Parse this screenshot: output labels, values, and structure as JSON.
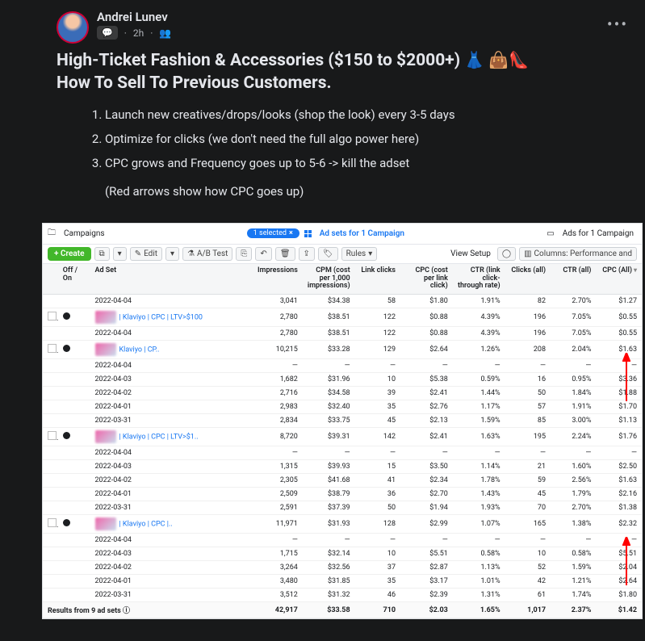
{
  "post": {
    "author": "Andrei Lunev",
    "time": "2h",
    "badge_glyph": "💬",
    "audience_glyph": "👥",
    "headline_plain": "High-Ticket Fashion & Accessories ($150 to $2000+)",
    "headline_emoji": "👗 👜👠",
    "headline_line2": "How To Sell To Previous Customers.",
    "tips": [
      "Launch new creatives/drops/looks (shop the look) every 3-5 days",
      "Optimize for clicks (we don't need the full algo power here)",
      "CPC grows and Frequency goes up to 5-6 -> kill the adset"
    ],
    "note": "(Red arrows show how CPC goes up)"
  },
  "ads": {
    "tabs": {
      "campaigns": "Campaigns",
      "selected_pill": "1 selected",
      "adsets": "Ad sets for 1 Campaign",
      "ads": "Ads for 1 Campaign"
    },
    "toolbar": {
      "create": "+ Create",
      "edit": "Edit",
      "abtest": "A/B Test",
      "rules": "Rules",
      "view_setup": "View Setup",
      "columns": "Columns: Performance and"
    },
    "headers": {
      "off_on": "Off / On",
      "ad_set": "Ad Set",
      "impressions": "Impressions",
      "cpm": "CPM (cost per 1,000 impressions)",
      "link_clicks": "Link clicks",
      "cpc_link": "CPC (cost per link click)",
      "ctr_link": "CTR (link click-through rate)",
      "clicks_all": "Clicks (all)",
      "ctr_all": "CTR (all)",
      "cpc_all": "CPC (All)"
    },
    "rows": [
      {
        "type": "data",
        "date": "2022-04-04",
        "impr": "3,041",
        "cpm": "$34.38",
        "lc": "58",
        "cpc": "$1.80",
        "ctr": "1.91%",
        "ca": "82",
        "ctra": "2.70%",
        "cpca": "$1.27"
      },
      {
        "type": "adset",
        "name": "| Klaviyo | CPC | LTV>$100",
        "impr": "2,780",
        "cpm": "$38.51",
        "lc": "122",
        "cpc": "$0.88",
        "ctr": "4.39%",
        "ca": "196",
        "ctra": "7.05%",
        "cpca": "$0.55"
      },
      {
        "type": "data",
        "date": "2022-04-04",
        "impr": "2,780",
        "cpm": "$38.51",
        "lc": "122",
        "cpc": "$0.88",
        "ctr": "4.39%",
        "ca": "196",
        "ctra": "7.05%",
        "cpca": "$0.55"
      },
      {
        "type": "adset",
        "name": "Klaviyo | CP..",
        "impr": "10,215",
        "cpm": "$33.28",
        "lc": "129",
        "cpc": "$2.64",
        "ctr": "1.26%",
        "ca": "208",
        "ctra": "2.04%",
        "cpca": "$1.63"
      },
      {
        "type": "empty",
        "date": "2022-04-04"
      },
      {
        "type": "data",
        "date": "2022-04-03",
        "impr": "1,682",
        "cpm": "$31.96",
        "lc": "10",
        "cpc": "$5.38",
        "ctr": "0.59%",
        "ca": "16",
        "ctra": "0.95%",
        "cpca": "$3.36"
      },
      {
        "type": "data",
        "date": "2022-04-02",
        "impr": "2,716",
        "cpm": "$34.58",
        "lc": "39",
        "cpc": "$2.41",
        "ctr": "1.44%",
        "ca": "50",
        "ctra": "1.84%",
        "cpca": "$1.88"
      },
      {
        "type": "data",
        "date": "2022-04-01",
        "impr": "2,983",
        "cpm": "$32.40",
        "lc": "35",
        "cpc": "$2.76",
        "ctr": "1.17%",
        "ca": "57",
        "ctra": "1.91%",
        "cpca": "$1.70"
      },
      {
        "type": "data",
        "date": "2022-03-31",
        "impr": "2,834",
        "cpm": "$33.75",
        "lc": "45",
        "cpc": "$2.13",
        "ctr": "1.59%",
        "ca": "85",
        "ctra": "3.00%",
        "cpca": "$1.13"
      },
      {
        "type": "adset",
        "name": "| Klaviyo | CPC | LTV>$1..",
        "impr": "8,720",
        "cpm": "$39.31",
        "lc": "142",
        "cpc": "$2.41",
        "ctr": "1.63%",
        "ca": "195",
        "ctra": "2.24%",
        "cpca": "$1.76"
      },
      {
        "type": "empty",
        "date": "2022-04-04"
      },
      {
        "type": "data",
        "date": "2022-04-03",
        "impr": "1,315",
        "cpm": "$39.93",
        "lc": "15",
        "cpc": "$3.50",
        "ctr": "1.14%",
        "ca": "21",
        "ctra": "1.60%",
        "cpca": "$2.50"
      },
      {
        "type": "data",
        "date": "2022-04-02",
        "impr": "2,305",
        "cpm": "$41.68",
        "lc": "41",
        "cpc": "$2.34",
        "ctr": "1.78%",
        "ca": "59",
        "ctra": "2.56%",
        "cpca": "$1.63"
      },
      {
        "type": "data",
        "date": "2022-04-01",
        "impr": "2,509",
        "cpm": "$38.79",
        "lc": "36",
        "cpc": "$2.70",
        "ctr": "1.43%",
        "ca": "45",
        "ctra": "1.79%",
        "cpca": "$2.16"
      },
      {
        "type": "data",
        "date": "2022-03-31",
        "impr": "2,591",
        "cpm": "$37.39",
        "lc": "50",
        "cpc": "$1.94",
        "ctr": "1.93%",
        "ca": "70",
        "ctra": "2.70%",
        "cpca": "$1.38"
      },
      {
        "type": "adset",
        "name": "| Klaviyo | CPC |..",
        "impr": "11,971",
        "cpm": "$31.93",
        "lc": "128",
        "cpc": "$2.99",
        "ctr": "1.07%",
        "ca": "165",
        "ctra": "1.38%",
        "cpca": "$2.32"
      },
      {
        "type": "empty",
        "date": "2022-04-04"
      },
      {
        "type": "data",
        "date": "2022-04-03",
        "impr": "1,715",
        "cpm": "$32.14",
        "lc": "10",
        "cpc": "$5.51",
        "ctr": "0.58%",
        "ca": "10",
        "ctra": "0.58%",
        "cpca": "$5.51"
      },
      {
        "type": "data",
        "date": "2022-04-02",
        "impr": "3,264",
        "cpm": "$32.56",
        "lc": "37",
        "cpc": "$2.87",
        "ctr": "1.13%",
        "ca": "52",
        "ctra": "1.59%",
        "cpca": "$2.04"
      },
      {
        "type": "data",
        "date": "2022-04-01",
        "impr": "3,480",
        "cpm": "$31.85",
        "lc": "35",
        "cpc": "$3.17",
        "ctr": "1.01%",
        "ca": "42",
        "ctra": "1.21%",
        "cpca": "$2.64"
      },
      {
        "type": "data",
        "date": "2022-03-31",
        "impr": "3,512",
        "cpm": "$31.32",
        "lc": "46",
        "cpc": "$2.39",
        "ctr": "1.31%",
        "ca": "61",
        "ctra": "1.74%",
        "cpca": "$1.80"
      }
    ],
    "totals": {
      "label": "Results from 9 ad sets ⓘ",
      "impr": "42,917",
      "cpm": "$33.58",
      "lc": "710",
      "cpc": "$2.03",
      "ctr": "1.65%",
      "ca": "1,017",
      "ctra": "2.37%",
      "cpca": "$1.42"
    }
  }
}
